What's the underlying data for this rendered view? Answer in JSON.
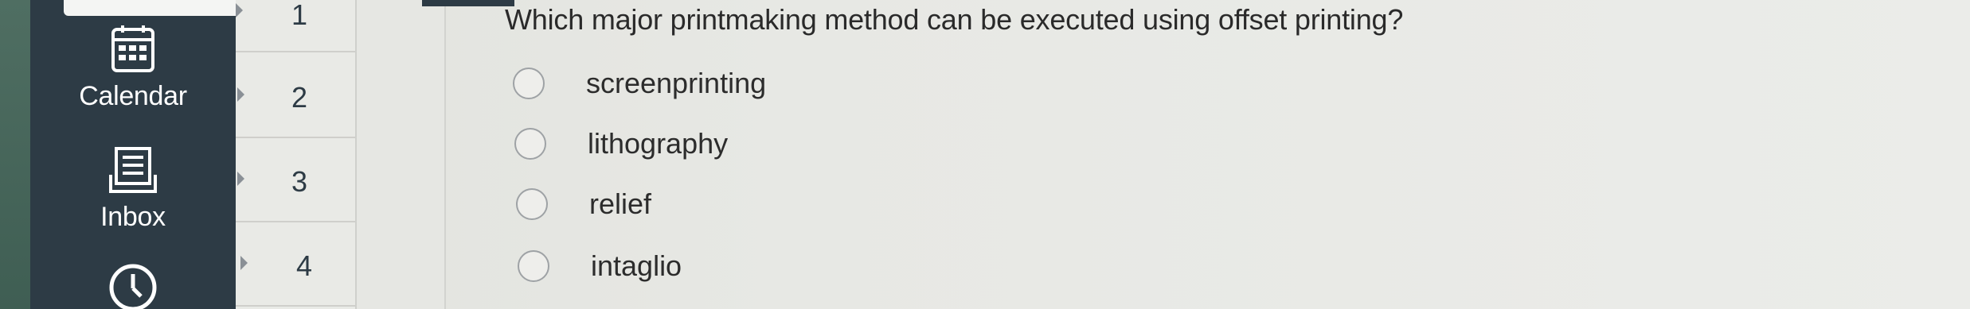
{
  "nav": {
    "items": [
      {
        "label": "Calendar",
        "icon": "calendar-icon"
      },
      {
        "label": "Inbox",
        "icon": "inbox-icon"
      },
      {
        "label": "",
        "icon": "clock-icon"
      }
    ]
  },
  "question_list": {
    "items": [
      "1",
      "2",
      "3",
      "4"
    ]
  },
  "question": {
    "text": "Which major printmaking method can be executed using offset printing?",
    "options": [
      "screenprinting",
      "lithography",
      "relief",
      "intaglio"
    ]
  },
  "colors": {
    "nav_background": "#2d3b45",
    "edge_strip": "#4a685c",
    "page_background": "#e8e9e5"
  }
}
